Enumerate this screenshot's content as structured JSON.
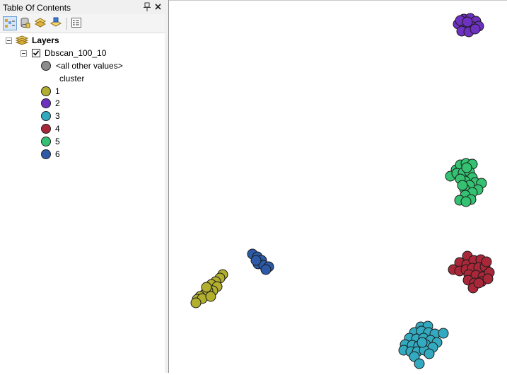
{
  "toc": {
    "title": "Table Of Contents",
    "toolbar_icons": [
      "list-by-drawing-order-icon",
      "list-by-source-icon",
      "list-by-visibility-icon",
      "list-by-selection-icon",
      "options-icon"
    ]
  },
  "tree": {
    "root_label": "Layers",
    "layer": {
      "name": "Dbscan_100_10",
      "visible": true,
      "all_other_values_label": "<all other values>",
      "field_heading": "cluster",
      "classes": [
        {
          "label": "1",
          "color": "#b2ae2e"
        },
        {
          "label": "2",
          "color": "#6e32c0"
        },
        {
          "label": "3",
          "color": "#33aabf"
        },
        {
          "label": "4",
          "color": "#a8283a"
        },
        {
          "label": "5",
          "color": "#34c272"
        },
        {
          "label": "6",
          "color": "#2c5aa6"
        }
      ],
      "other_color": "#8c8c8c"
    }
  },
  "map": {
    "clusters": [
      {
        "class": "2",
        "color": "#6e32c0",
        "points": [
          [
            656,
            27
          ],
          [
            665,
            26
          ],
          [
            673,
            30
          ],
          [
            648,
            34
          ],
          [
            658,
            36
          ],
          [
            669,
            38
          ],
          [
            677,
            37
          ],
          [
            653,
            44
          ],
          [
            663,
            45
          ],
          [
            672,
            41
          ],
          [
            651,
            29
          ],
          [
            661,
            31
          ]
        ]
      },
      {
        "class": "5",
        "color": "#34c272",
        "points": [
          [
            645,
            240
          ],
          [
            651,
            233
          ],
          [
            659,
            231
          ],
          [
            668,
            232
          ],
          [
            637,
            249
          ],
          [
            646,
            245
          ],
          [
            655,
            244
          ],
          [
            664,
            243
          ],
          [
            668,
            251
          ],
          [
            658,
            256
          ],
          [
            651,
            253
          ],
          [
            672,
            258
          ],
          [
            681,
            259
          ],
          [
            664,
            262
          ],
          [
            657,
            267
          ],
          [
            676,
            268
          ],
          [
            668,
            272
          ],
          [
            658,
            276
          ],
          [
            666,
            282
          ],
          [
            650,
            283
          ],
          [
            659,
            285
          ],
          [
            660,
            237
          ],
          [
            654,
            262
          ]
        ]
      },
      {
        "class": "4",
        "color": "#a8283a",
        "points": [
          [
            661,
            362
          ],
          [
            650,
            371
          ],
          [
            660,
            374
          ],
          [
            670,
            368
          ],
          [
            680,
            367
          ],
          [
            641,
            381
          ],
          [
            650,
            383
          ],
          [
            659,
            381
          ],
          [
            668,
            379
          ],
          [
            677,
            378
          ],
          [
            686,
            377
          ],
          [
            663,
            388
          ],
          [
            673,
            389
          ],
          [
            683,
            391
          ],
          [
            692,
            385
          ],
          [
            662,
            396
          ],
          [
            671,
            400
          ],
          [
            681,
            398
          ],
          [
            690,
            394
          ],
          [
            669,
            407
          ],
          [
            677,
            400
          ],
          [
            688,
            370
          ]
        ]
      },
      {
        "class": "3",
        "color": "#33aabf",
        "points": [
          [
            595,
            462
          ],
          [
            605,
            461
          ],
          [
            586,
            470
          ],
          [
            596,
            468
          ],
          [
            606,
            470
          ],
          [
            615,
            472
          ],
          [
            627,
            471
          ],
          [
            579,
            478
          ],
          [
            589,
            479
          ],
          [
            599,
            478
          ],
          [
            609,
            481
          ],
          [
            618,
            484
          ],
          [
            573,
            487
          ],
          [
            583,
            488
          ],
          [
            592,
            489
          ],
          [
            602,
            487
          ],
          [
            612,
            491
          ],
          [
            571,
            495
          ],
          [
            581,
            497
          ],
          [
            590,
            497
          ],
          [
            600,
            495
          ],
          [
            607,
            500
          ],
          [
            586,
            504
          ],
          [
            593,
            514
          ],
          [
            597,
            484
          ]
        ]
      },
      {
        "class": "6",
        "color": "#2c5aa6",
        "points": [
          [
            357,
            359
          ],
          [
            364,
            363
          ],
          [
            370,
            368
          ],
          [
            365,
            373
          ],
          [
            373,
            375
          ],
          [
            380,
            377
          ],
          [
            376,
            381
          ],
          [
            362,
            368
          ]
        ]
      },
      {
        "class": "1",
        "color": "#b2ae2e",
        "points": [
          [
            315,
            388
          ],
          [
            311,
            393
          ],
          [
            305,
            398
          ],
          [
            299,
            402
          ],
          [
            307,
            405
          ],
          [
            301,
            411
          ],
          [
            294,
            411
          ],
          [
            289,
            416
          ],
          [
            283,
            419
          ],
          [
            279,
            423
          ],
          [
            286,
            422
          ],
          [
            277,
            428
          ],
          [
            298,
            419
          ],
          [
            292,
            406
          ]
        ]
      }
    ]
  }
}
